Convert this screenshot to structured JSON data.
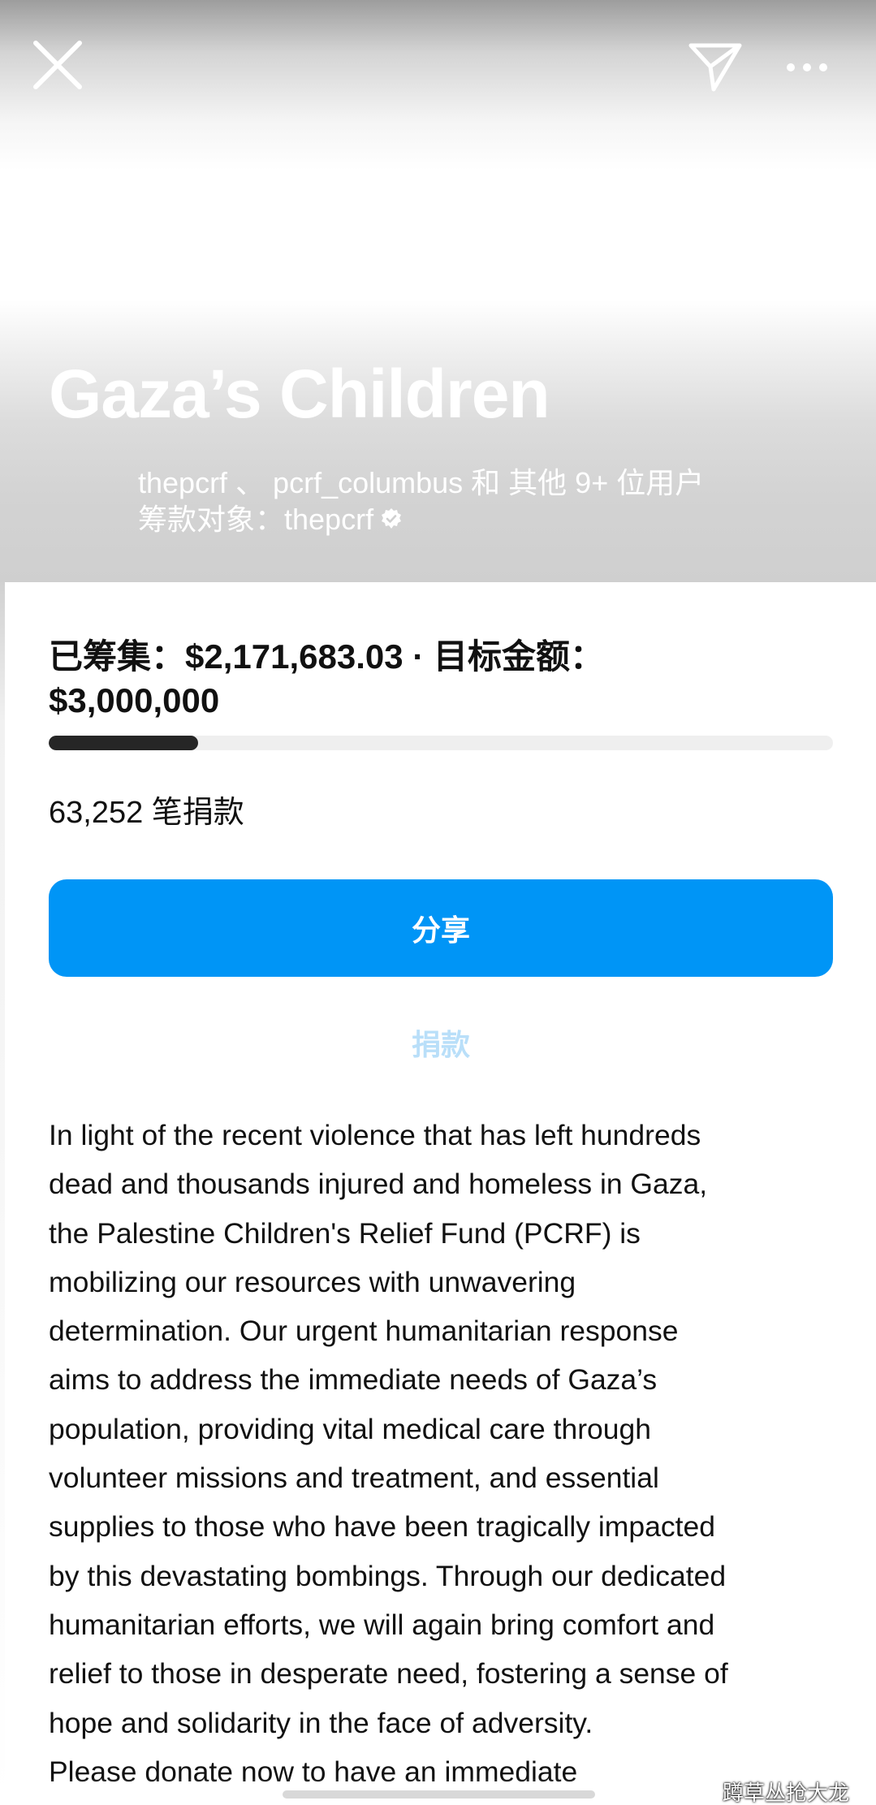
{
  "header": {
    "close_icon": "close-icon",
    "share_icon": "send-icon",
    "more_icon": "more-icon"
  },
  "fundraiser": {
    "title": "Gaza’s Children",
    "organizers": "thepcrf 、 pcrf_columbus 和 其他 9+ 位用户",
    "beneficiary_label": "筹款对象：",
    "beneficiary": "thepcrf",
    "verified": true
  },
  "progress": {
    "raised_label": "已筹集：",
    "raised_amount": "$2,171,683.03",
    "separator": " · ",
    "goal_label": "目标金额：",
    "goal_amount": "$3,000,000",
    "fraction": 0.19,
    "donation_count": "63,252 笔捐款"
  },
  "actions": {
    "share_label": "分享",
    "donate_label": "捐款"
  },
  "colors": {
    "accent": "#0095f6",
    "donate_text": "#b9dff9",
    "progress_fill": "#262626",
    "progress_track": "#efefef"
  },
  "description": {
    "lines": [
      "In light of the recent violence that has left hundreds",
      "dead and thousands injured and homeless in Gaza,",
      "the Palestine Children's Relief Fund (PCRF) is",
      "mobilizing our resources with unwavering",
      "determination. Our urgent humanitarian response",
      "aims to address the immediate needs of Gaza’s",
      "population, providing vital medical care through",
      "volunteer missions and treatment, and essential",
      "supplies to those who have been tragically impacted",
      "by this devastating bombings. Through our dedicated",
      "humanitarian efforts, we will again bring comfort and",
      "relief to those in desperate need, fostering a sense of",
      "hope and solidarity in the face of adversity.",
      "Please donate now to have an immediate"
    ]
  },
  "watermark": "蹲草丛抢大龙"
}
